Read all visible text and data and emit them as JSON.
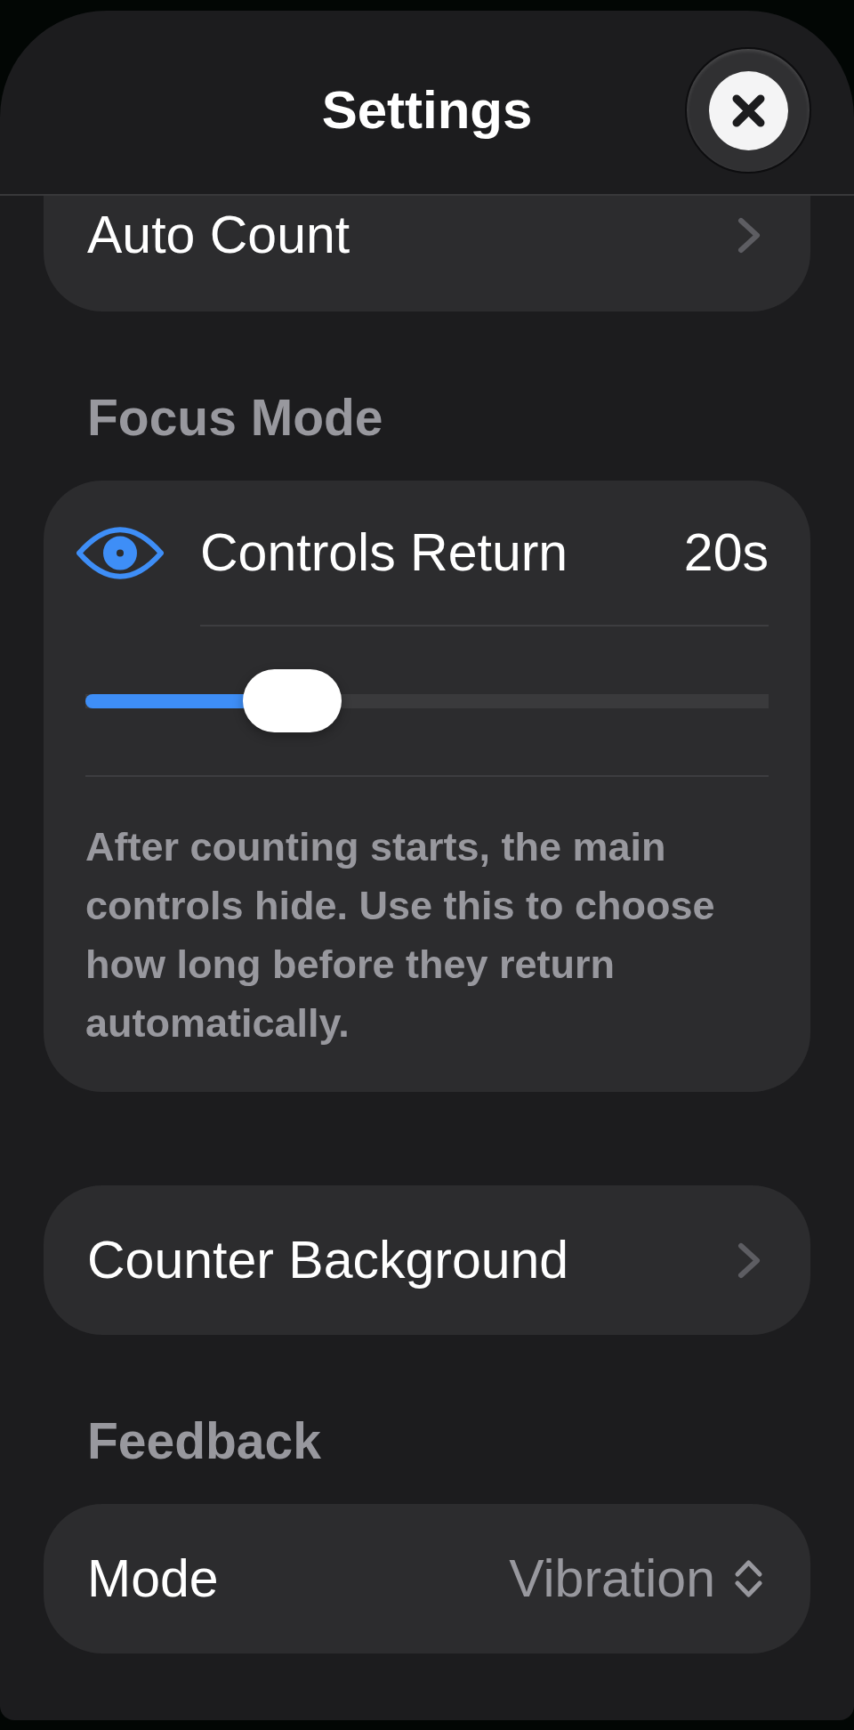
{
  "header": {
    "title": "Settings"
  },
  "sections": [
    {
      "items": [
        {
          "kind": "link",
          "label": "Auto Count"
        }
      ]
    },
    {
      "heading": "Focus Mode",
      "items": [
        {
          "kind": "slider",
          "label": "Controls Return",
          "value": "20s",
          "level": 0.27,
          "description": "After counting starts, the main controls hide. Use this to choose how long before they return automatically."
        }
      ]
    },
    {
      "items": [
        {
          "kind": "link",
          "label": "Counter Background"
        }
      ]
    },
    {
      "heading": "Feedback",
      "items": [
        {
          "kind": "picker",
          "label": "Mode",
          "value": "Vibration"
        }
      ]
    }
  ]
}
